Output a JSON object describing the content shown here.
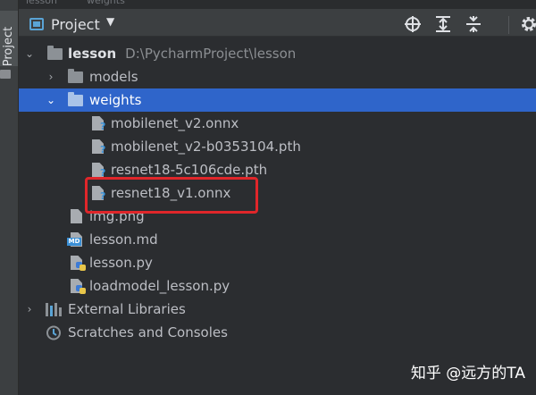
{
  "top_cut": [
    "lesson",
    "weights"
  ],
  "sidebar_tab": {
    "label": "Project"
  },
  "header": {
    "title": "Project",
    "caret": "▼",
    "buttons": [
      "target-icon",
      "expand-all-icon",
      "collapse-all-icon",
      "gear-icon"
    ]
  },
  "tree": [
    {
      "label": "lesson",
      "path": "D:\\PycharmProject\\lesson",
      "kind": "folder",
      "level": 0,
      "expanded": true
    },
    {
      "label": "models",
      "kind": "folder",
      "level": 1,
      "expanded": false
    },
    {
      "label": "weights",
      "kind": "folder",
      "level": 1,
      "expanded": true,
      "selected": true
    },
    {
      "label": "mobilenet_v2.onnx",
      "kind": "unknown-file",
      "level": 2
    },
    {
      "label": "mobilenet_v2-b0353104.pth",
      "kind": "unknown-file",
      "level": 2
    },
    {
      "label": "resnet18-5c106cde.pth",
      "kind": "unknown-file",
      "level": 2
    },
    {
      "label": "resnet18_v1.onnx",
      "kind": "unknown-file",
      "level": 2,
      "highlighted": true
    },
    {
      "label": "img.png",
      "kind": "image-file",
      "level": 1
    },
    {
      "label": "lesson.md",
      "kind": "markdown-file",
      "level": 1
    },
    {
      "label": "lesson.py",
      "kind": "python-file",
      "level": 1
    },
    {
      "label": "loadmodel_lesson.py",
      "kind": "python-file",
      "level": 1
    },
    {
      "label": "External Libraries",
      "kind": "libraries",
      "level": 0,
      "expanded": false
    },
    {
      "label": "Scratches and Consoles",
      "kind": "scratches",
      "level": 0
    }
  ],
  "highlight_color": "#e0262a",
  "selection_color": "#2f65ca",
  "watermark": "知乎 @远方的TA"
}
